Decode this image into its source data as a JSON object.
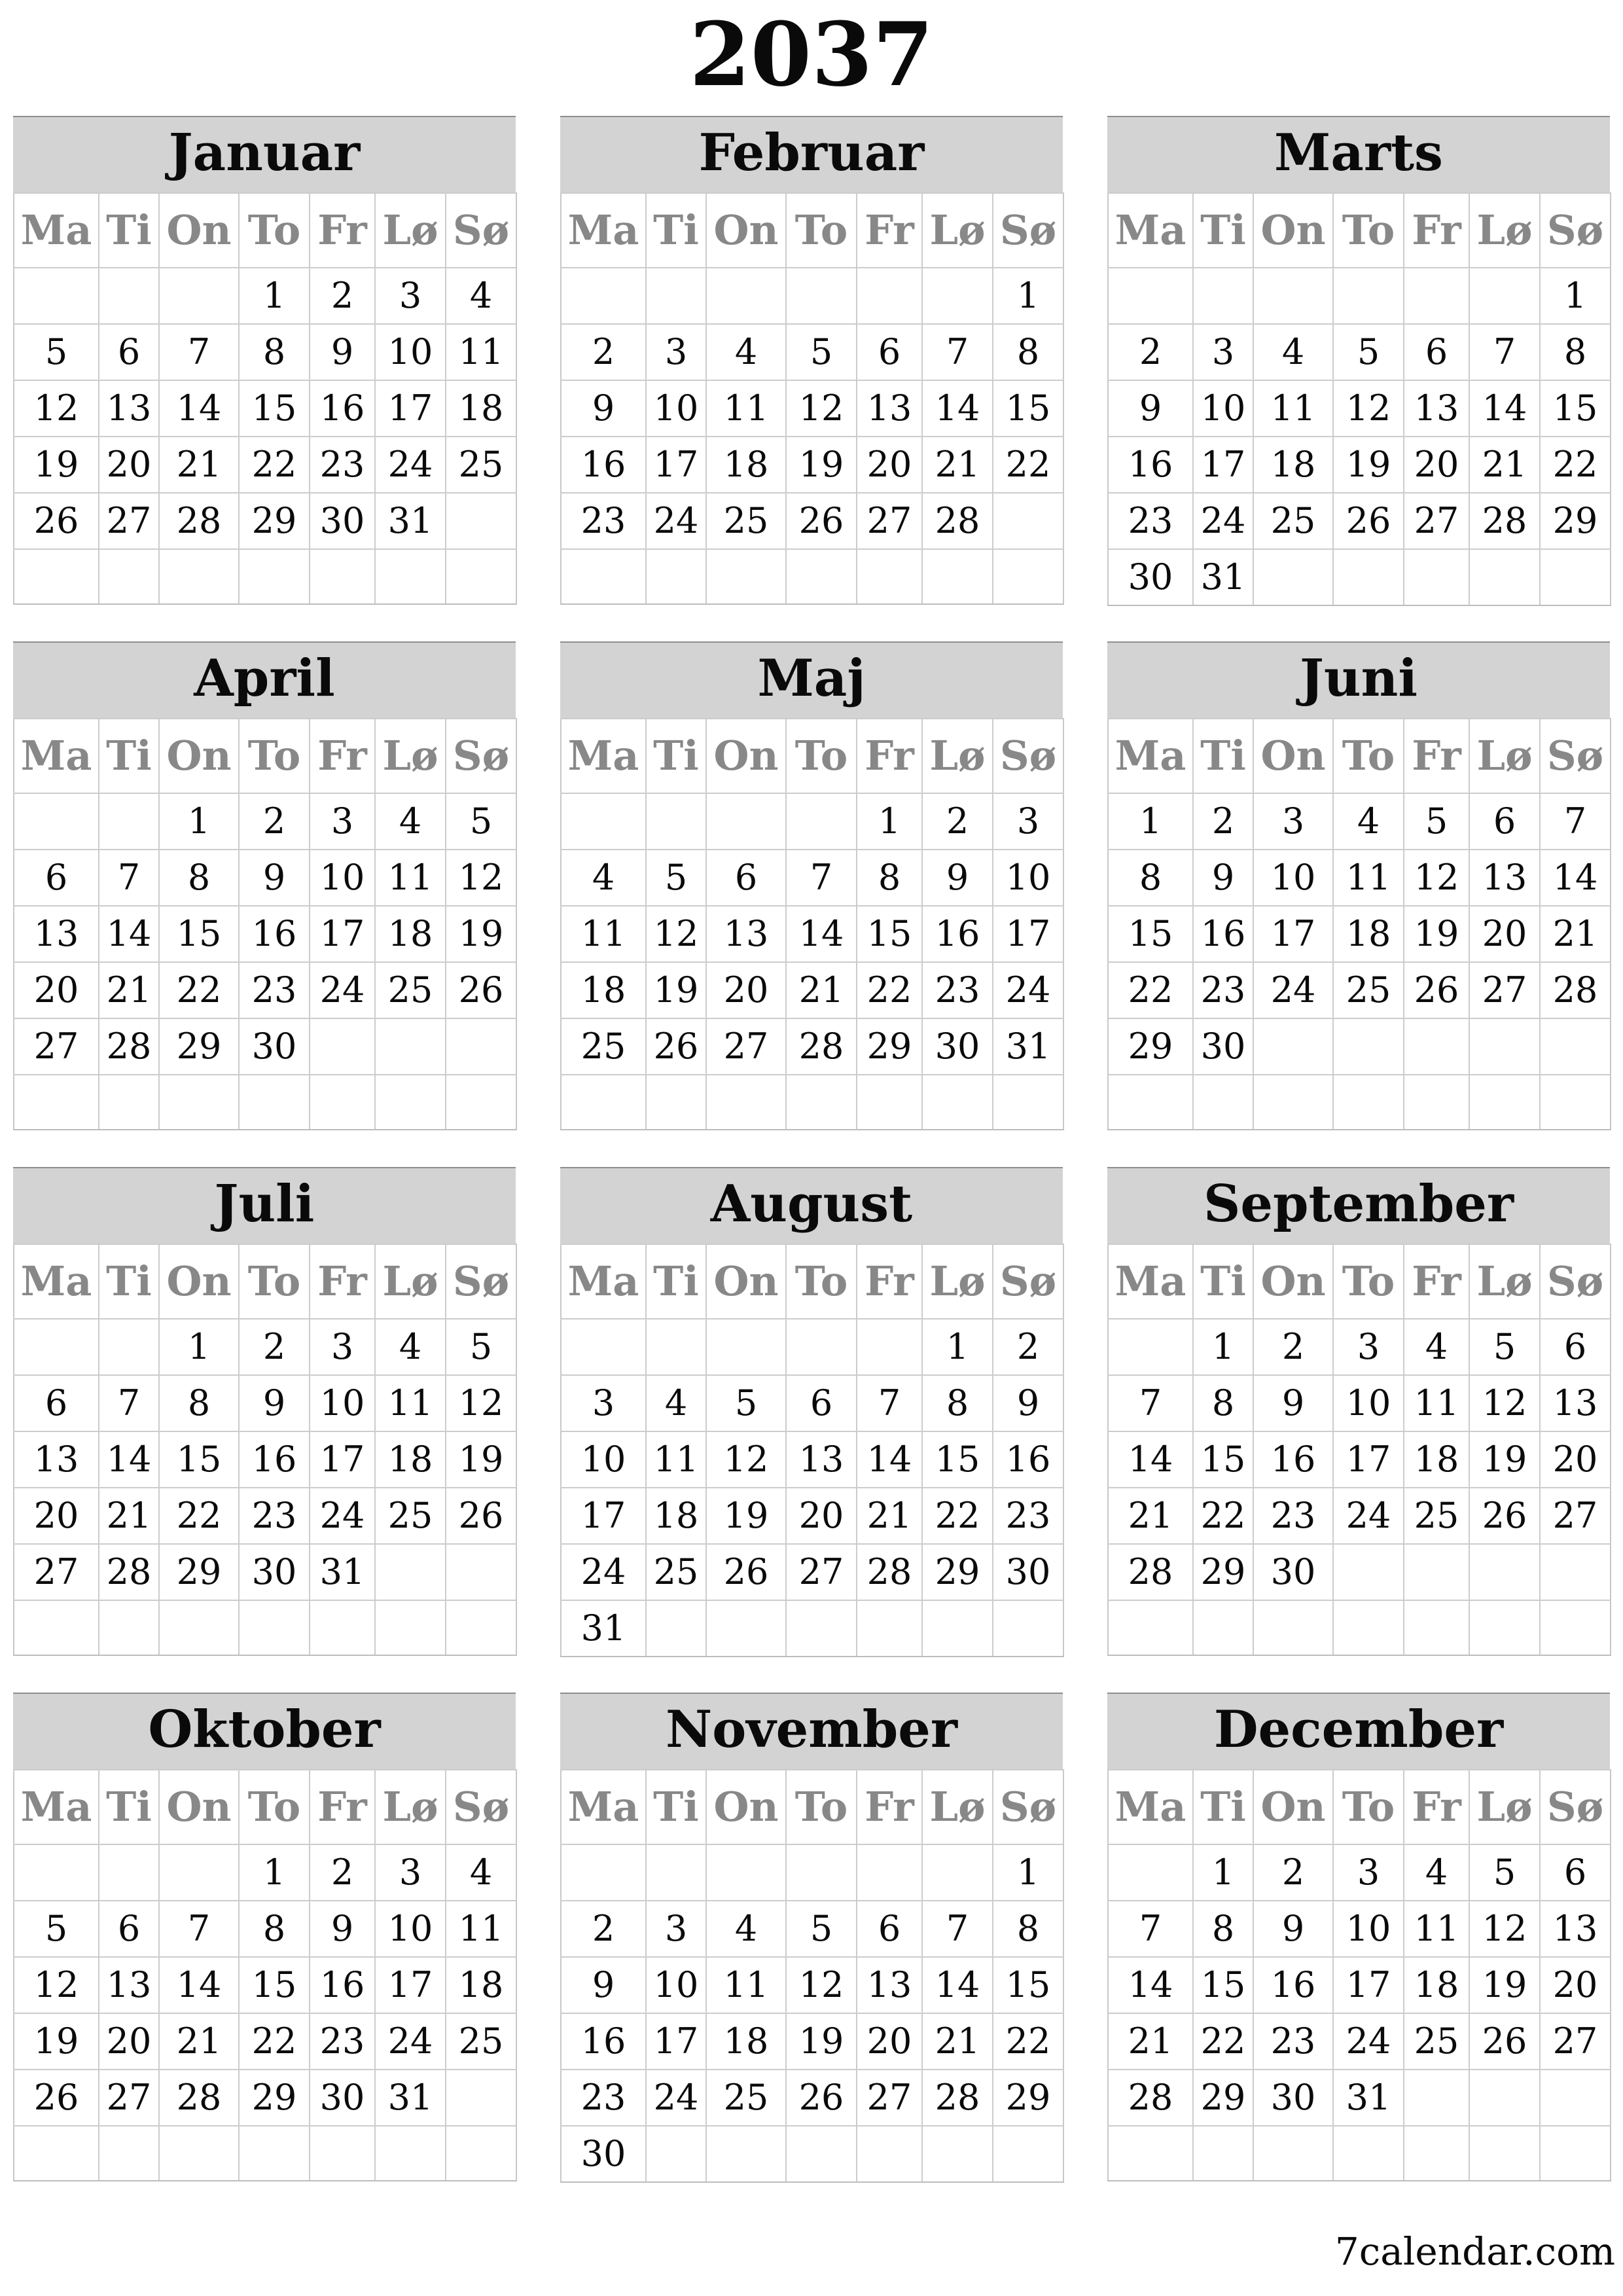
{
  "title": "2037",
  "weekdays": [
    "Ma",
    "Ti",
    "On",
    "To",
    "Fr",
    "Lø",
    "Sø"
  ],
  "months": [
    {
      "name": "Januar",
      "weeks": [
        [
          "",
          "",
          "",
          "1",
          "2",
          "3",
          "4"
        ],
        [
          "5",
          "6",
          "7",
          "8",
          "9",
          "10",
          "11"
        ],
        [
          "12",
          "13",
          "14",
          "15",
          "16",
          "17",
          "18"
        ],
        [
          "19",
          "20",
          "21",
          "22",
          "23",
          "24",
          "25"
        ],
        [
          "26",
          "27",
          "28",
          "29",
          "30",
          "31",
          ""
        ],
        [
          "",
          "",
          "",
          "",
          "",
          "",
          ""
        ]
      ]
    },
    {
      "name": "Februar",
      "weeks": [
        [
          "",
          "",
          "",
          "",
          "",
          "",
          "1"
        ],
        [
          "2",
          "3",
          "4",
          "5",
          "6",
          "7",
          "8"
        ],
        [
          "9",
          "10",
          "11",
          "12",
          "13",
          "14",
          "15"
        ],
        [
          "16",
          "17",
          "18",
          "19",
          "20",
          "21",
          "22"
        ],
        [
          "23",
          "24",
          "25",
          "26",
          "27",
          "28",
          ""
        ],
        [
          "",
          "",
          "",
          "",
          "",
          "",
          ""
        ]
      ]
    },
    {
      "name": "Marts",
      "weeks": [
        [
          "",
          "",
          "",
          "",
          "",
          "",
          "1"
        ],
        [
          "2",
          "3",
          "4",
          "5",
          "6",
          "7",
          "8"
        ],
        [
          "9",
          "10",
          "11",
          "12",
          "13",
          "14",
          "15"
        ],
        [
          "16",
          "17",
          "18",
          "19",
          "20",
          "21",
          "22"
        ],
        [
          "23",
          "24",
          "25",
          "26",
          "27",
          "28",
          "29"
        ],
        [
          "30",
          "31",
          "",
          "",
          "",
          "",
          ""
        ]
      ]
    },
    {
      "name": "April",
      "weeks": [
        [
          "",
          "",
          "1",
          "2",
          "3",
          "4",
          "5"
        ],
        [
          "6",
          "7",
          "8",
          "9",
          "10",
          "11",
          "12"
        ],
        [
          "13",
          "14",
          "15",
          "16",
          "17",
          "18",
          "19"
        ],
        [
          "20",
          "21",
          "22",
          "23",
          "24",
          "25",
          "26"
        ],
        [
          "27",
          "28",
          "29",
          "30",
          "",
          "",
          ""
        ],
        [
          "",
          "",
          "",
          "",
          "",
          "",
          ""
        ]
      ]
    },
    {
      "name": "Maj",
      "weeks": [
        [
          "",
          "",
          "",
          "",
          "1",
          "2",
          "3"
        ],
        [
          "4",
          "5",
          "6",
          "7",
          "8",
          "9",
          "10"
        ],
        [
          "11",
          "12",
          "13",
          "14",
          "15",
          "16",
          "17"
        ],
        [
          "18",
          "19",
          "20",
          "21",
          "22",
          "23",
          "24"
        ],
        [
          "25",
          "26",
          "27",
          "28",
          "29",
          "30",
          "31"
        ],
        [
          "",
          "",
          "",
          "",
          "",
          "",
          ""
        ]
      ]
    },
    {
      "name": "Juni",
      "weeks": [
        [
          "1",
          "2",
          "3",
          "4",
          "5",
          "6",
          "7"
        ],
        [
          "8",
          "9",
          "10",
          "11",
          "12",
          "13",
          "14"
        ],
        [
          "15",
          "16",
          "17",
          "18",
          "19",
          "20",
          "21"
        ],
        [
          "22",
          "23",
          "24",
          "25",
          "26",
          "27",
          "28"
        ],
        [
          "29",
          "30",
          "",
          "",
          "",
          "",
          ""
        ],
        [
          "",
          "",
          "",
          "",
          "",
          "",
          ""
        ]
      ]
    },
    {
      "name": "Juli",
      "weeks": [
        [
          "",
          "",
          "1",
          "2",
          "3",
          "4",
          "5"
        ],
        [
          "6",
          "7",
          "8",
          "9",
          "10",
          "11",
          "12"
        ],
        [
          "13",
          "14",
          "15",
          "16",
          "17",
          "18",
          "19"
        ],
        [
          "20",
          "21",
          "22",
          "23",
          "24",
          "25",
          "26"
        ],
        [
          "27",
          "28",
          "29",
          "30",
          "31",
          "",
          ""
        ],
        [
          "",
          "",
          "",
          "",
          "",
          "",
          ""
        ]
      ]
    },
    {
      "name": "August",
      "weeks": [
        [
          "",
          "",
          "",
          "",
          "",
          "1",
          "2"
        ],
        [
          "3",
          "4",
          "5",
          "6",
          "7",
          "8",
          "9"
        ],
        [
          "10",
          "11",
          "12",
          "13",
          "14",
          "15",
          "16"
        ],
        [
          "17",
          "18",
          "19",
          "20",
          "21",
          "22",
          "23"
        ],
        [
          "24",
          "25",
          "26",
          "27",
          "28",
          "29",
          "30"
        ],
        [
          "31",
          "",
          "",
          "",
          "",
          "",
          ""
        ]
      ]
    },
    {
      "name": "September",
      "weeks": [
        [
          "",
          "1",
          "2",
          "3",
          "4",
          "5",
          "6"
        ],
        [
          "7",
          "8",
          "9",
          "10",
          "11",
          "12",
          "13"
        ],
        [
          "14",
          "15",
          "16",
          "17",
          "18",
          "19",
          "20"
        ],
        [
          "21",
          "22",
          "23",
          "24",
          "25",
          "26",
          "27"
        ],
        [
          "28",
          "29",
          "30",
          "",
          "",
          "",
          ""
        ],
        [
          "",
          "",
          "",
          "",
          "",
          "",
          ""
        ]
      ]
    },
    {
      "name": "Oktober",
      "weeks": [
        [
          "",
          "",
          "",
          "1",
          "2",
          "3",
          "4"
        ],
        [
          "5",
          "6",
          "7",
          "8",
          "9",
          "10",
          "11"
        ],
        [
          "12",
          "13",
          "14",
          "15",
          "16",
          "17",
          "18"
        ],
        [
          "19",
          "20",
          "21",
          "22",
          "23",
          "24",
          "25"
        ],
        [
          "26",
          "27",
          "28",
          "29",
          "30",
          "31",
          ""
        ],
        [
          "",
          "",
          "",
          "",
          "",
          "",
          ""
        ]
      ]
    },
    {
      "name": "November",
      "weeks": [
        [
          "",
          "",
          "",
          "",
          "",
          "",
          "1"
        ],
        [
          "2",
          "3",
          "4",
          "5",
          "6",
          "7",
          "8"
        ],
        [
          "9",
          "10",
          "11",
          "12",
          "13",
          "14",
          "15"
        ],
        [
          "16",
          "17",
          "18",
          "19",
          "20",
          "21",
          "22"
        ],
        [
          "23",
          "24",
          "25",
          "26",
          "27",
          "28",
          "29"
        ],
        [
          "30",
          "",
          "",
          "",
          "",
          "",
          ""
        ]
      ]
    },
    {
      "name": "December",
      "weeks": [
        [
          "",
          "1",
          "2",
          "3",
          "4",
          "5",
          "6"
        ],
        [
          "7",
          "8",
          "9",
          "10",
          "11",
          "12",
          "13"
        ],
        [
          "14",
          "15",
          "16",
          "17",
          "18",
          "19",
          "20"
        ],
        [
          "21",
          "22",
          "23",
          "24",
          "25",
          "26",
          "27"
        ],
        [
          "28",
          "29",
          "30",
          "31",
          "",
          "",
          ""
        ],
        [
          "",
          "",
          "",
          "",
          "",
          "",
          ""
        ]
      ]
    }
  ],
  "footer": "7calendar.com"
}
